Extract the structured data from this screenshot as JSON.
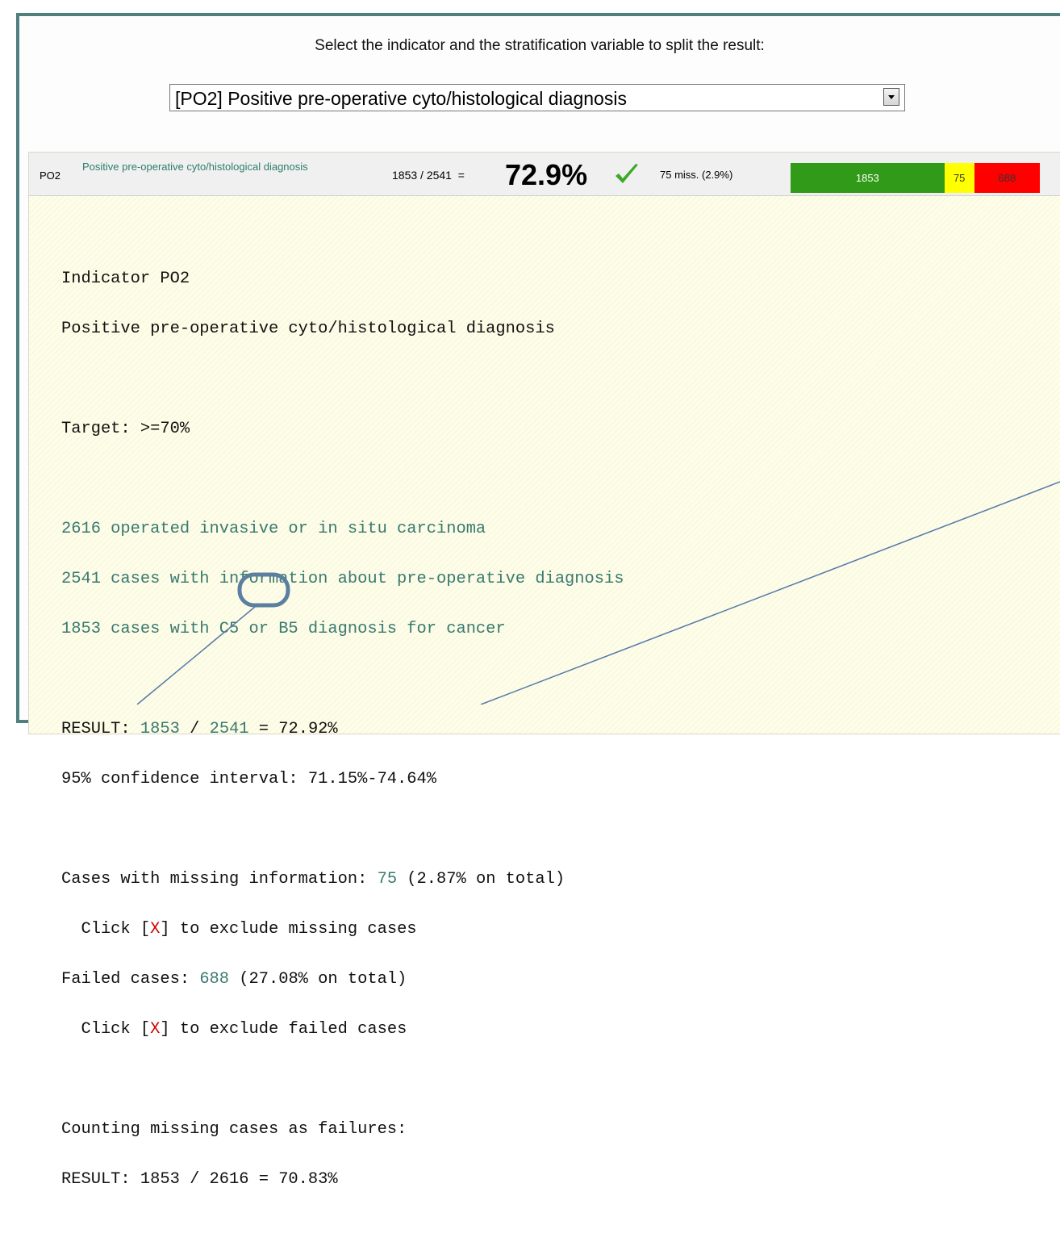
{
  "instruction": "Select the indicator and the stratification variable to split the result:",
  "indicator_select": {
    "selected": "[PO2] Positive pre-operative cyto/histological diagnosis"
  },
  "summary": {
    "code": "PO2",
    "name": "Positive pre-operative cyto/histological diagnosis",
    "fraction": "1853 / 2541",
    "equals": "=",
    "percent": "72.9%",
    "missing": "75 miss. (2.9%)",
    "bar": [
      {
        "label": "1853",
        "value": 1853,
        "color": "#319a18"
      },
      {
        "label": "75",
        "value": 75,
        "color": "#ffff00"
      },
      {
        "label": "688",
        "value": 688,
        "color": "#ff0000"
      }
    ]
  },
  "detail": {
    "title": "Indicator PO2",
    "subtitle": "Positive pre-operative cyto/histological diagnosis",
    "target": "Target: >=70%",
    "counts": [
      "2616 operated invasive or in situ carcinoma",
      "2541 cases with information about pre-operative diagnosis",
      "1853 cases with C5 or B5 diagnosis for cancer"
    ],
    "result_label": "RESULT:",
    "result_num": "1853",
    "result_sep": " / ",
    "result_den": "2541",
    "result_eq": " = 72.92%",
    "ci": "95% confidence interval: 71.15%-74.64%",
    "missing_label": "Cases with missing information: ",
    "missing_value": "75",
    "missing_pct": " (2.87% on total)",
    "click_prefix": "  Click [",
    "click_x": "X",
    "click_missing_suffix": "] to exclude missing cases",
    "failed_label": "Failed cases: ",
    "failed_value": "688",
    "failed_pct": " (27.08% on total)",
    "click_failed_suffix": "] to exclude failed cases",
    "counting_label": "Counting missing cases as failures:",
    "result2": "RESULT: 1853 / 2616 = 70.83%"
  }
}
